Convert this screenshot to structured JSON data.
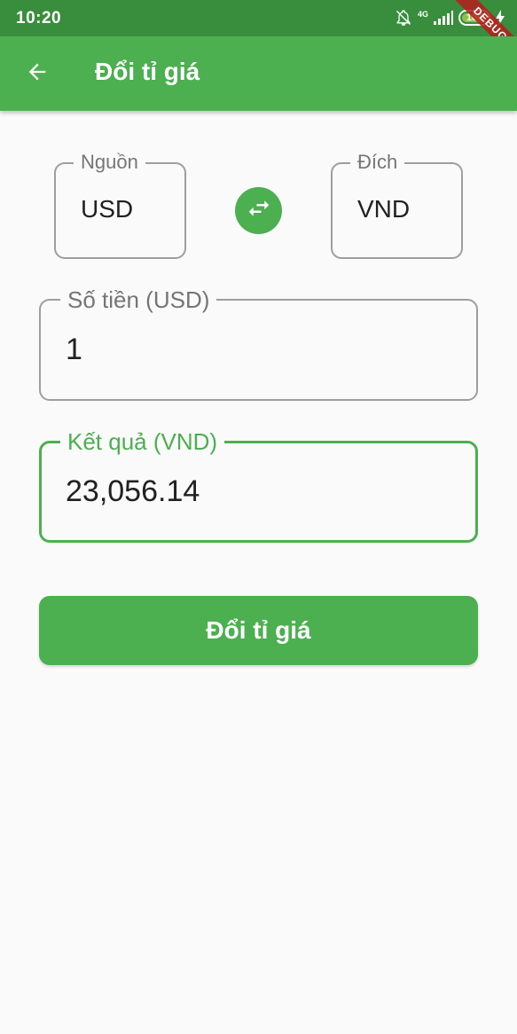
{
  "status_bar": {
    "time": "10:20",
    "network_type": "4G",
    "battery_level": "100",
    "icons": [
      "notifications-off-icon",
      "signal-icon",
      "battery-icon",
      "charging-icon"
    ]
  },
  "debug_banner": "DEBUG",
  "app_bar": {
    "title": "Đổi tỉ giá",
    "back_icon": "arrow-back-icon"
  },
  "currency_selector": {
    "source_label": "Nguồn",
    "source_value": "USD",
    "target_label": "Đích",
    "target_value": "VND",
    "swap_icon": "swap-horiz-icon"
  },
  "amount": {
    "label": "Số tiền (USD)",
    "value": "1"
  },
  "result": {
    "label": "Kết quả (VND)",
    "value": "23,056.14"
  },
  "convert_button_label": "Đổi tỉ giá",
  "colors": {
    "primary": "#4caf50",
    "primary_dark": "#388e3c",
    "background": "#fafafa",
    "text": "#212121",
    "label": "#757575",
    "border": "#9e9e9e"
  }
}
